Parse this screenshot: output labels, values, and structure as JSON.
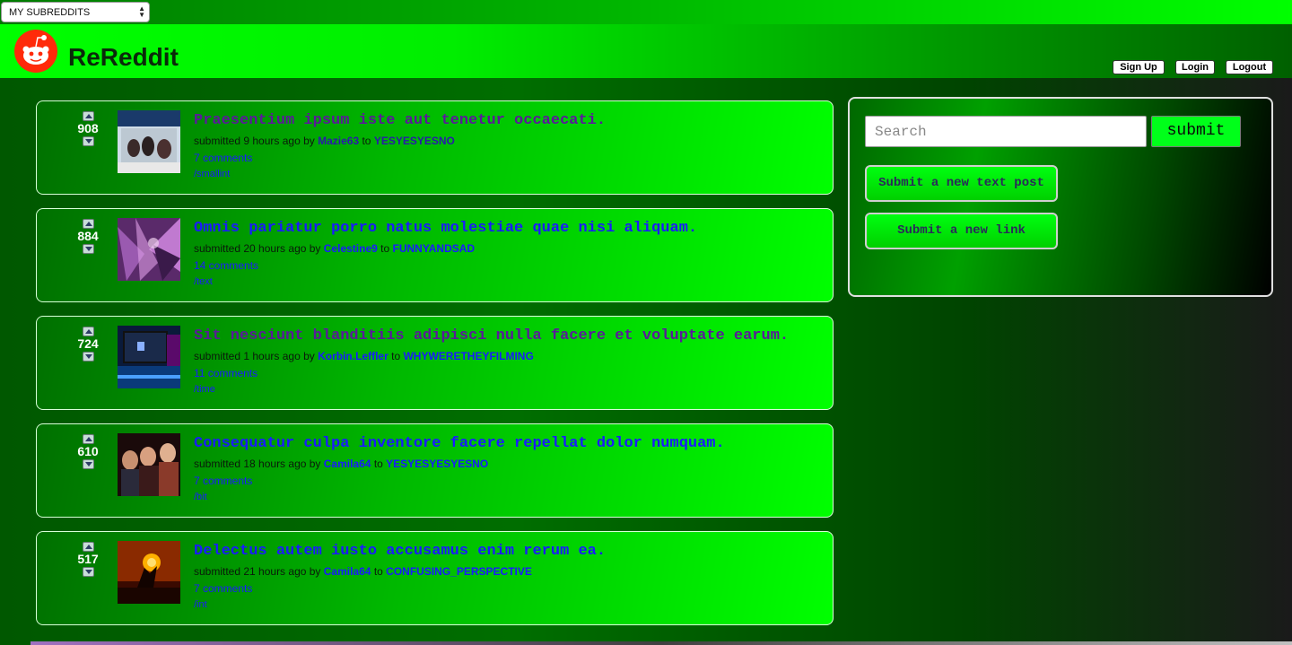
{
  "topbar": {
    "subreddit_select": "MY SUBREDDITS"
  },
  "header": {
    "brand": "ReReddit",
    "signup": "Sign Up",
    "login": "Login",
    "logout": "Logout"
  },
  "posts": [
    {
      "score": "908",
      "title": "Praesentium ipsum iste aut tenetur occaecati.",
      "submitted_prefix": "submitted 9 hours ago by",
      "author": "Mazie63",
      "to": "to",
      "subreddit": "YESYESYESNO",
      "comments": "7 comments",
      "path": "/smallint",
      "visited": true
    },
    {
      "score": "884",
      "title": "Omnis pariatur porro natus molestiae quae nisi aliquam.",
      "submitted_prefix": "submitted 20 hours ago by",
      "author": "Celestine9",
      "to": "to",
      "subreddit": "FUNNYANDSAD",
      "comments": "14 comments",
      "path": "/text",
      "visited": false
    },
    {
      "score": "724",
      "title": "Sit nesciunt blanditiis adipisci nulla facere et voluptate earum.",
      "submitted_prefix": "submitted 1 hours ago by",
      "author": "Korbin.Leffler",
      "to": "to",
      "subreddit": "WHYWERETHEYFILMING",
      "comments": "11 comments",
      "path": "/time",
      "visited": true
    },
    {
      "score": "610",
      "title": "Consequatur culpa inventore facere repellat dolor numquam.",
      "submitted_prefix": "submitted 18 hours ago by",
      "author": "Camila64",
      "to": "to",
      "subreddit": "YESYESYESYESNO",
      "comments": "7 comments",
      "path": "/bit",
      "visited": false
    },
    {
      "score": "517",
      "title": "Delectus autem iusto accusamus enim rerum ea.",
      "submitted_prefix": "submitted 21 hours ago by",
      "author": "Camila64",
      "to": "to",
      "subreddit": "CONFUSING_PERSPECTIVE",
      "comments": "7 comments",
      "path": "/int",
      "visited": false
    }
  ],
  "sidebar": {
    "search_placeholder": "Search",
    "submit": "submit",
    "new_text_post": "Submit a new text post",
    "new_link": "Submit a new link"
  }
}
